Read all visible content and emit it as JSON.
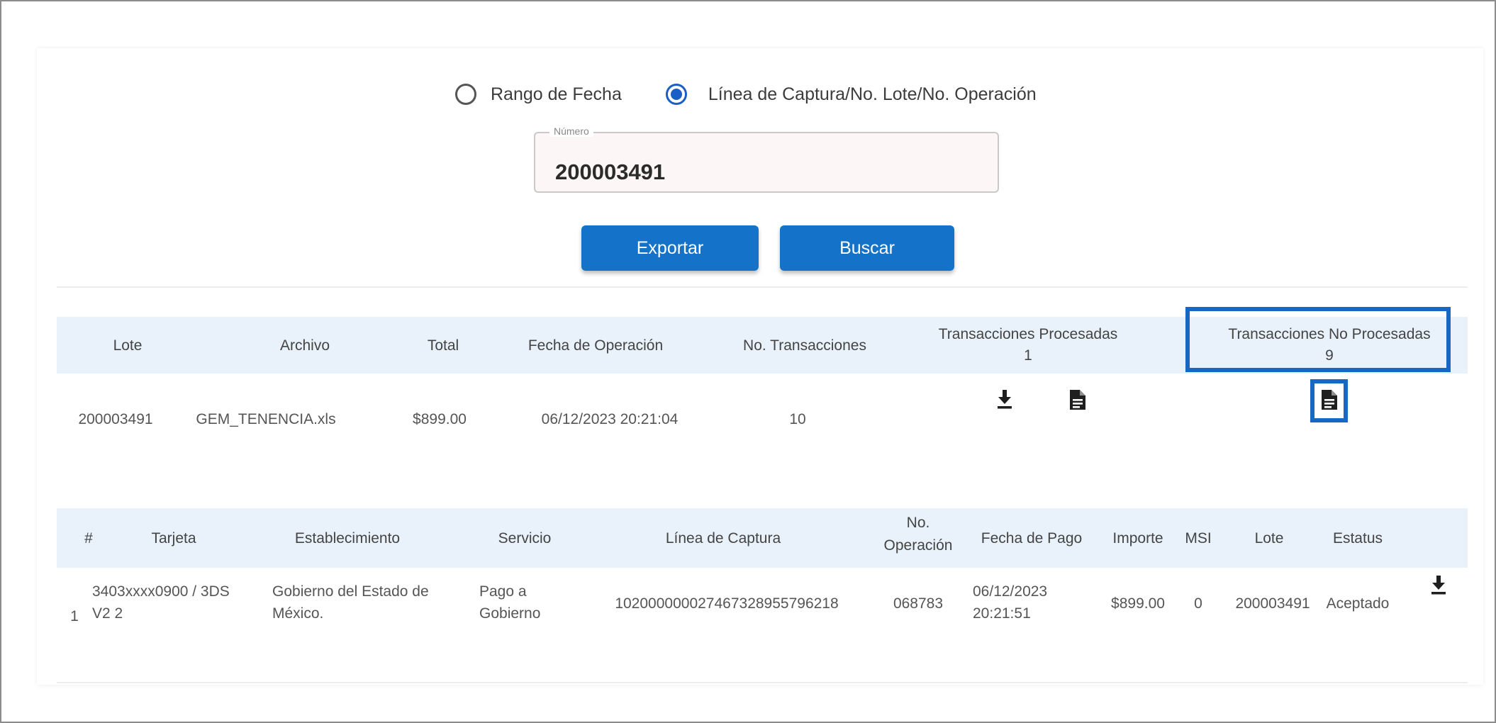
{
  "search": {
    "options": [
      {
        "label": "Rango de Fecha",
        "checked": false
      },
      {
        "label": "Línea de Captura/No. Lote/No. Operación",
        "checked": true
      }
    ],
    "number_legend": "Número",
    "number_value": "200003491",
    "export_label": "Exportar",
    "search_label": "Buscar"
  },
  "batch_table": {
    "headers": {
      "lote": "Lote",
      "archivo": "Archivo",
      "total": "Total",
      "fecha": "Fecha de Operación",
      "no_trans": "No. Transacciones",
      "procesadas": "Transacciones Procesadas",
      "procesadas_count": "1",
      "no_procesadas": "Transacciones No Procesadas",
      "no_procesadas_count": "9"
    },
    "row": {
      "lote": "200003491",
      "archivo": "GEM_TENENCIA.xls",
      "total": "$899.00",
      "fecha": "06/12/2023 20:21:04",
      "no_trans": "10"
    },
    "icons": [
      "download-icon",
      "file-icon",
      "file-icon"
    ]
  },
  "tx_table": {
    "headers": {
      "num": "#",
      "tarjeta": "Tarjeta",
      "establecimiento": "Establecimiento",
      "servicio": "Servicio",
      "linea": "Línea de Captura",
      "no_op_1": "No.",
      "no_op_2": "Operación",
      "fecha_pago": "Fecha de Pago",
      "importe": "Importe",
      "msi": "MSI",
      "lote": "Lote",
      "estatus": "Estatus"
    },
    "rows": [
      {
        "num": "1",
        "tarjeta_1": "3403xxxx0900 / 3DS",
        "tarjeta_2": "V2 2",
        "establecimiento_1": "Gobierno del Estado de",
        "establecimiento_2": "México.",
        "servicio_1": "Pago a",
        "servicio_2": "Gobierno",
        "linea": "102000000027467328955796218",
        "no_op": "068783",
        "fecha_1": "06/12/2023",
        "fecha_2": "20:21:51",
        "importe": "$899.00",
        "msi": "0",
        "lote": "200003491",
        "estatus": "Aceptado"
      }
    ]
  },
  "colors": {
    "primary": "#1473c9",
    "header_band": "#e9f2fb",
    "highlight": "#1668c4"
  }
}
